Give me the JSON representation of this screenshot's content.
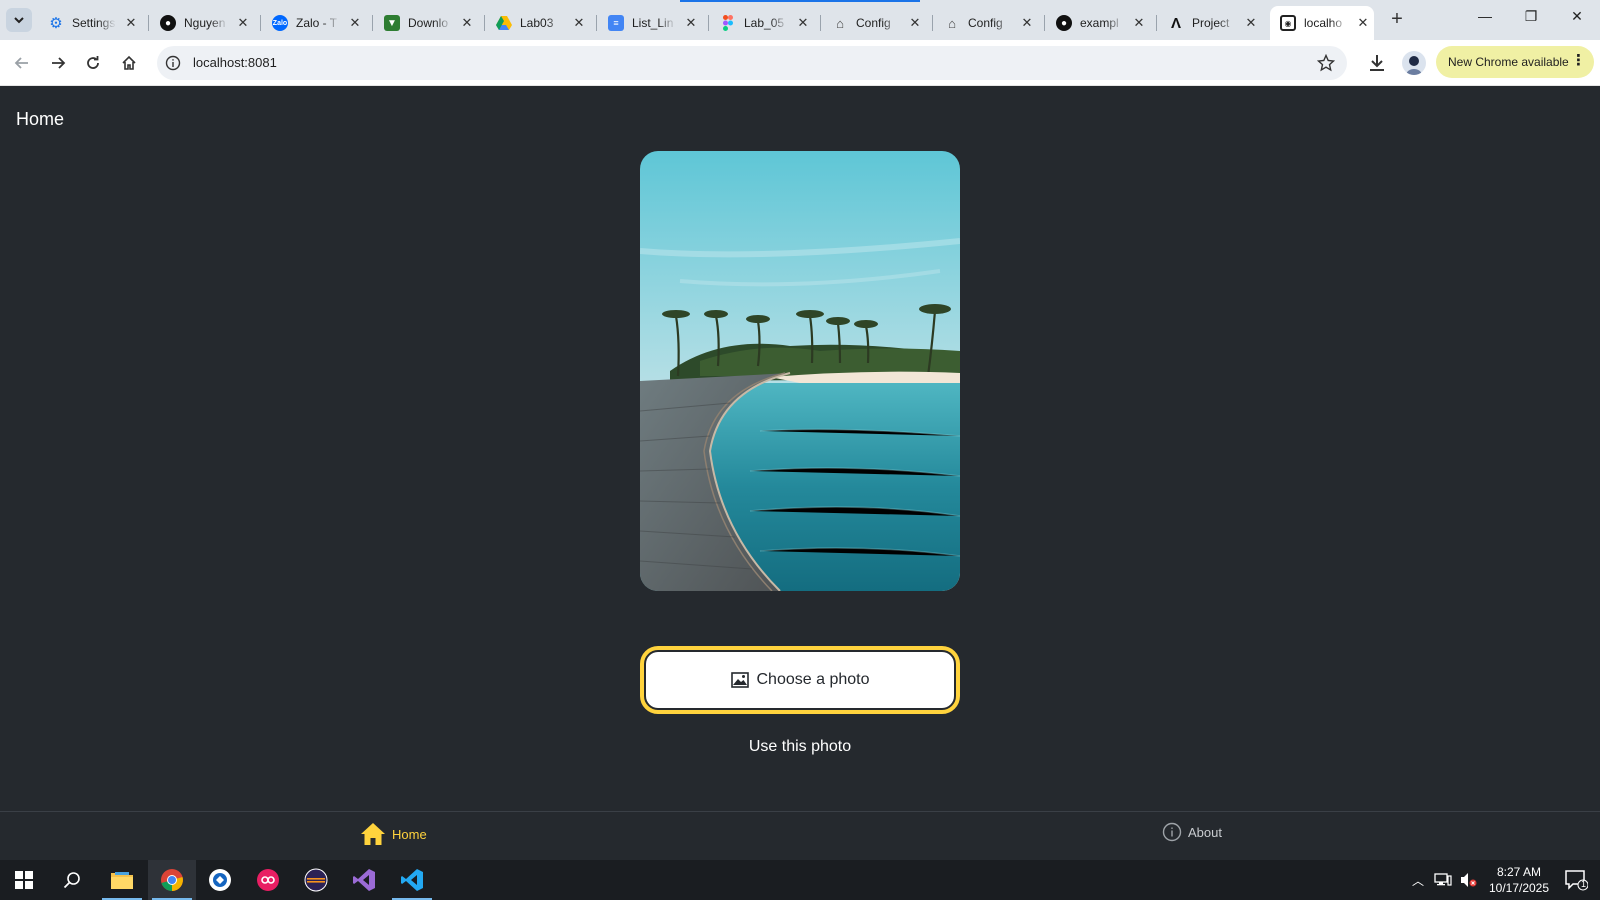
{
  "browser": {
    "tabs": [
      {
        "label": "Settings",
        "icon": "gear-icon",
        "color": "#1a73e8"
      },
      {
        "label": "Nguyen",
        "icon": "github-icon",
        "color": "#111111"
      },
      {
        "label": "Zalo - T",
        "icon": "zalo-icon",
        "color": "#0068ff"
      },
      {
        "label": "Downlo",
        "icon": "download-favicon-icon",
        "color": "#2e7d32"
      },
      {
        "label": "Lab03",
        "icon": "google-drive-icon",
        "color": "#fbbc04"
      },
      {
        "label": "List_Lin",
        "icon": "google-docs-icon",
        "color": "#4285f4"
      },
      {
        "label": "Lab_05",
        "icon": "figma-icon",
        "color": "#f24e1e"
      },
      {
        "label": "Config",
        "icon": "config-icon",
        "color": "#444444"
      },
      {
        "label": "Config",
        "icon": "config-icon",
        "color": "#444444"
      },
      {
        "label": "exampl",
        "icon": "github-icon",
        "color": "#111111"
      },
      {
        "label": "Project",
        "icon": "project-icon",
        "color": "#111111"
      },
      {
        "label": "localho",
        "icon": "localhost-icon",
        "color": "#222222",
        "active": true
      }
    ],
    "url": "localhost:8081",
    "update_label": "New Chrome available"
  },
  "app": {
    "title": "Home",
    "choose_label": "Choose a photo",
    "use_label": "Use this photo",
    "accent_color": "#ffd33d",
    "background_color": "#25292e",
    "tabbar": {
      "home_label": "Home",
      "about_label": "About"
    }
  },
  "taskbar": {
    "time": "8:27 AM",
    "date": "10/17/2025",
    "notification_count": "1"
  }
}
